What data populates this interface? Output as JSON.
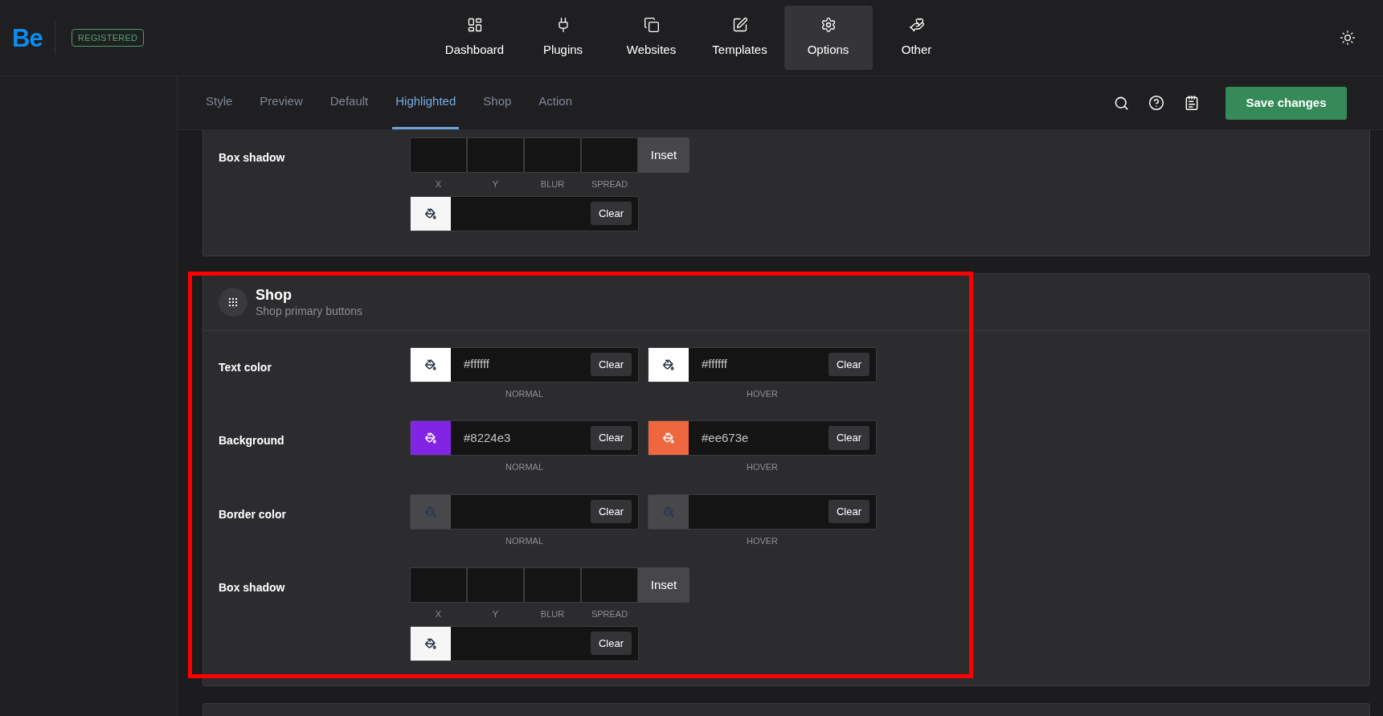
{
  "brand": {
    "logo": "Be",
    "badge": "REGISTERED"
  },
  "nav": [
    {
      "label": "Dashboard",
      "selected": false
    },
    {
      "label": "Plugins",
      "selected": false
    },
    {
      "label": "Websites",
      "selected": false
    },
    {
      "label": "Templates",
      "selected": false
    },
    {
      "label": "Options",
      "selected": true
    },
    {
      "label": "Other",
      "selected": false
    }
  ],
  "tabs": [
    {
      "label": "Style",
      "selected": false
    },
    {
      "label": "Preview",
      "selected": false
    },
    {
      "label": "Default",
      "selected": false
    },
    {
      "label": "Highlighted",
      "selected": true
    },
    {
      "label": "Shop",
      "selected": false
    },
    {
      "label": "Action",
      "selected": false
    }
  ],
  "save_button": "Save changes",
  "sections": [
    {
      "rows": [
        {
          "kind": "shadow",
          "label": "Box shadow",
          "inputs": [
            "X",
            "Y",
            "BLUR",
            "SPREAD"
          ],
          "inset": "Inset",
          "color_field": {
            "color": "#f5f6f5",
            "button": "Clear"
          }
        }
      ]
    },
    {
      "title": "Shop",
      "subtitle": "Shop primary buttons",
      "rows": [
        {
          "kind": "colors",
          "label": "Text color",
          "fields": [
            {
              "color": "#ffffff",
              "value": "#ffffff",
              "button": "Clear",
              "caption": "NORMAL"
            },
            {
              "color": "#ffffff",
              "value": "#ffffff",
              "button": "Clear",
              "caption": "HOVER"
            }
          ]
        },
        {
          "kind": "colors",
          "label": "Background",
          "fields": [
            {
              "color": "#8224e3",
              "value": "#8224e3",
              "button": "Clear",
              "caption": "NORMAL"
            },
            {
              "color": "#ee673e",
              "value": "#ee673e",
              "button": "Clear",
              "caption": "HOVER"
            }
          ]
        },
        {
          "kind": "colors",
          "label": "Border color",
          "fields": [
            {
              "color": "#48474c",
              "button": "Clear",
              "caption": "NORMAL"
            },
            {
              "color": "#48474c",
              "button": "Clear",
              "caption": "HOVER"
            }
          ]
        },
        {
          "kind": "shadow",
          "label": "Box shadow",
          "inputs": [
            "X",
            "Y",
            "BLUR",
            "SPREAD"
          ],
          "inset": "Inset",
          "color_field": {
            "color": "#f5f6f5",
            "button": "Clear"
          }
        }
      ]
    }
  ]
}
